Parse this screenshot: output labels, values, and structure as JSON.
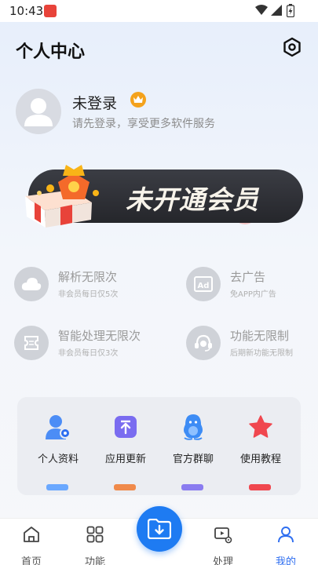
{
  "status_bar": {
    "time": "10:43"
  },
  "header": {
    "title": "个人中心"
  },
  "user": {
    "name": "未登录",
    "subtitle": "请先登录，享受更多软件服务"
  },
  "vip_banner": {
    "label": "未开通会员"
  },
  "benefits": [
    {
      "title": "解析无限次",
      "subtitle": "非会员每日仅5次",
      "icon": "cloud-icon"
    },
    {
      "title": "去广告",
      "subtitle": "免APP内广告",
      "icon": "ad-icon"
    },
    {
      "title": "智能处理无限次",
      "subtitle": "非会员每日仅3次",
      "icon": "ticket-icon"
    },
    {
      "title": "功能无限制",
      "subtitle": "后期新功能无限制",
      "icon": "headset-icon"
    }
  ],
  "tools": [
    {
      "label": "个人资料",
      "icon": "user-profile-icon"
    },
    {
      "label": "应用更新",
      "icon": "upload-icon"
    },
    {
      "label": "官方群聊",
      "icon": "qq-penguin-icon"
    },
    {
      "label": "使用教程",
      "icon": "star-icon"
    }
  ],
  "bottom_nav": [
    {
      "label": "首页",
      "icon": "home-icon"
    },
    {
      "label": "功能",
      "icon": "grid-icon"
    },
    {
      "label": "处理",
      "icon": "process-icon"
    },
    {
      "label": "我的",
      "icon": "person-icon",
      "active": true
    }
  ],
  "colors": {
    "accent": "#2e6ef0",
    "fab": "#1e7bf2",
    "crown": "#f4a21c",
    "vip_bg": "#2b2c31"
  }
}
